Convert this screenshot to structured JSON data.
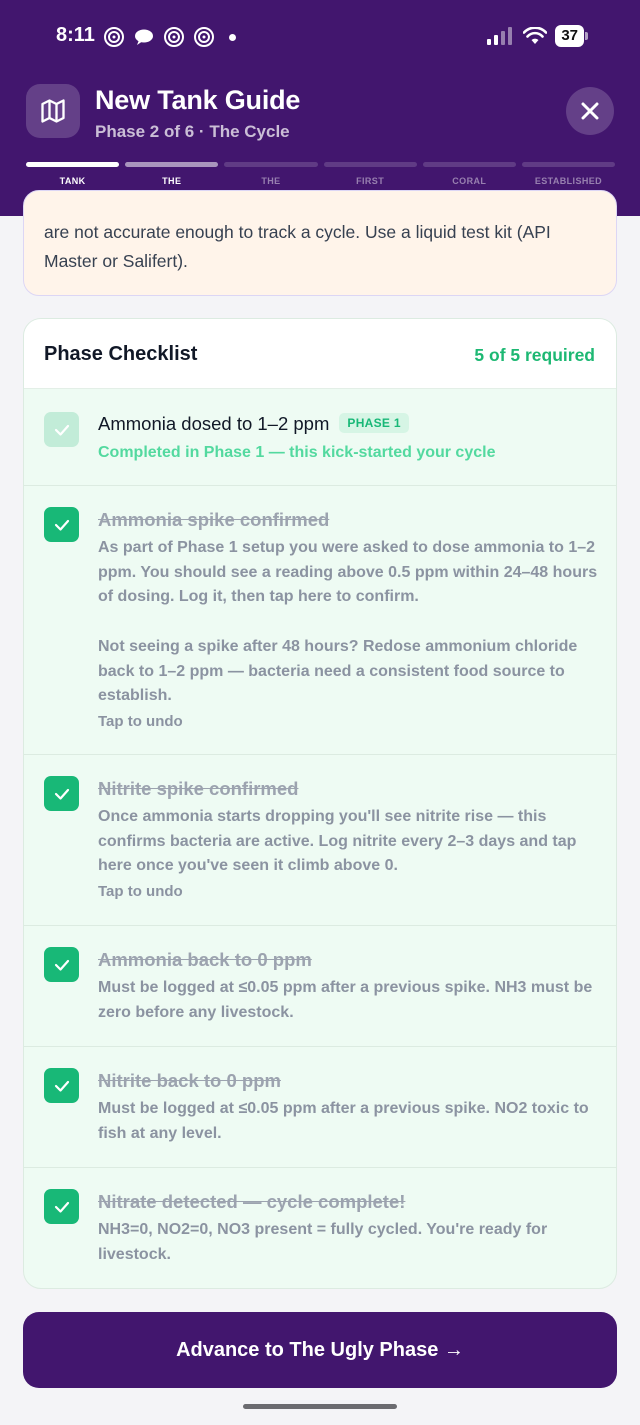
{
  "status": {
    "time": "8:11",
    "battery": "37"
  },
  "header": {
    "title": "New Tank Guide",
    "subtitle": "Phase 2 of 6 · The Cycle",
    "steps": [
      "TANK",
      "THE",
      "THE",
      "FIRST",
      "CORAL",
      "ESTABLISHED"
    ]
  },
  "note": {
    "text": "are not accurate enough to track a cycle. Use a liquid test kit (API Master or Salifert)."
  },
  "checklist": {
    "title": "Phase Checklist",
    "count": "5 of 5 required",
    "items": [
      {
        "title": "Ammonia dosed to 1–2 ppm",
        "badge": "PHASE 1",
        "desc": "Completed in Phase 1 — this kick-started your cycle"
      },
      {
        "title": "Ammonia spike confirmed",
        "desc": "As part of Phase 1 setup you were asked to dose ammonia to 1–2 ppm. You should see a reading above 0.5 ppm within 24–48 hours of dosing. Log it, then tap here to confirm.",
        "desc2": "Not seeing a spike after 48 hours? Redose ammonium chloride back to 1–2 ppm — bacteria need a consistent food source to establish.",
        "undo": "Tap to undo"
      },
      {
        "title": "Nitrite spike confirmed",
        "desc": "Once ammonia starts dropping you'll see nitrite rise — this confirms bacteria are active. Log nitrite every 2–3 days and tap here once you've seen it climb above 0.",
        "undo": "Tap to undo"
      },
      {
        "title": "Ammonia back to 0 ppm",
        "desc": "Must be logged at ≤0.05 ppm after a previous spike. NH3 must be zero before any livestock."
      },
      {
        "title": "Nitrite back to 0 ppm",
        "desc": "Must be logged at ≤0.05 ppm after a previous spike. NO2 toxic to fish at any level."
      },
      {
        "title": "Nitrate detected — cycle complete!",
        "desc": "NH3=0, NO2=0, NO3 present = fully cycled. You're ready for livestock."
      }
    ]
  },
  "cta": {
    "label": "Advance to The Ugly Phase →"
  },
  "colors": {
    "brand": "#42166e",
    "success": "#18b877"
  }
}
